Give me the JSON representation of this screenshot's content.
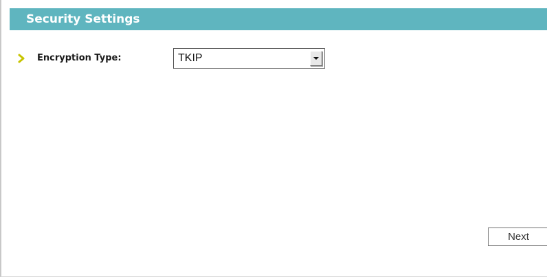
{
  "panel": {
    "title": "Security Settings"
  },
  "form": {
    "encryption_type": {
      "label": "Encryption Type:",
      "selected_value": "TKIP"
    }
  },
  "actions": {
    "next_label": "Next"
  },
  "colors": {
    "header_bar": "#5fb5bf",
    "header_text": "#ffffff",
    "bullet": "#c7c400"
  },
  "icons": {
    "row_bullet": "chevron-right-icon",
    "dropdown_arrow": "chevron-down-icon"
  }
}
